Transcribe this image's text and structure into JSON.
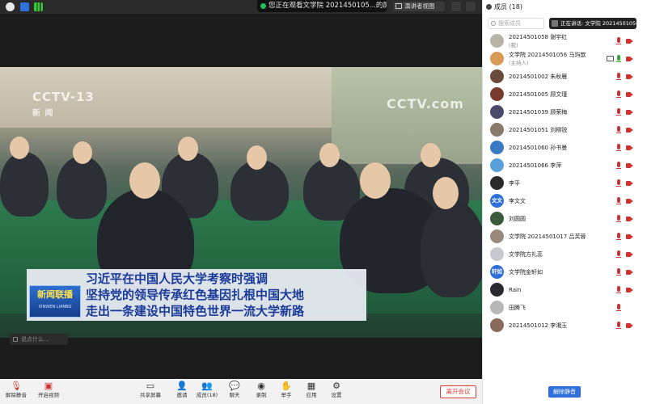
{
  "topbar": {
    "share_banner": "您正在观看文学院 20214501​05...的屏幕",
    "view_button": "演讲者视图"
  },
  "video": {
    "cctv_left": "CCTV-13",
    "cctv_left_sub": "新 闻",
    "cctv_right": "CCTV.com",
    "news_logo_cn": "新闻联播",
    "news_logo_py": "XINWEN LIANBO",
    "captions": [
      "习近平在中国人民大学考察时强调",
      "坚持党的领导传承红色基因扎根中国大地",
      "走出一条建设中国特色世界一流大学新路"
    ]
  },
  "chat_input": {
    "placeholder": "说点什么..."
  },
  "toolbar": {
    "items": [
      {
        "label": "解除静音",
        "icon": "mic-muted-icon"
      },
      {
        "label": "开启视频",
        "icon": "video-off-icon"
      },
      {
        "label": "共享屏幕",
        "icon": "share-screen-icon"
      },
      {
        "label": "邀请",
        "icon": "invite-icon"
      },
      {
        "label": "成员(18)",
        "icon": "members-icon"
      },
      {
        "label": "聊天",
        "icon": "chat-icon"
      },
      {
        "label": "录制",
        "icon": "record-icon"
      },
      {
        "label": "举手",
        "icon": "raise-hand-icon"
      },
      {
        "label": "应用",
        "icon": "apps-icon"
      },
      {
        "label": "设置",
        "icon": "settings-icon"
      }
    ],
    "leave_label": "离开会议"
  },
  "panel": {
    "title": "成员 (18)",
    "search_placeholder": "搜索成员",
    "speaking": "正在讲话: 文学院 20214501056...",
    "unmute_all": "解除静音",
    "members": [
      {
        "name": "20214501058 谢宇红",
        "sub": "(我)",
        "avatar_text": "",
        "avatar_color": "#b9b4a8",
        "mic": "muted",
        "cam": true,
        "screen": false
      },
      {
        "name": "文学院 20214501056 马玙歆",
        "sub": "(主持人)",
        "avatar_text": "",
        "avatar_color": "#d79b55",
        "mic": "on",
        "cam": true,
        "screen": true
      },
      {
        "name": "20214501002 朱秋雁",
        "sub": "",
        "avatar_text": "",
        "avatar_color": "#6a4a3a",
        "mic": "muted",
        "cam": true,
        "screen": false
      },
      {
        "name": "20214501005 顾文瑾",
        "sub": "",
        "avatar_text": "",
        "avatar_color": "#7a3b2e",
        "mic": "muted",
        "cam": true,
        "screen": false
      },
      {
        "name": "20214501039 顾荣梅",
        "sub": "",
        "avatar_text": "",
        "avatar_color": "#4a4a6a",
        "mic": "muted",
        "cam": true,
        "screen": false
      },
      {
        "name": "20214501051 刘柳锐",
        "sub": "",
        "avatar_text": "",
        "avatar_color": "#8a7a6a",
        "mic": "muted",
        "cam": true,
        "screen": false
      },
      {
        "name": "20214501060 孙书曼",
        "sub": "",
        "avatar_text": "",
        "avatar_color": "#3a7ac2",
        "mic": "muted",
        "cam": true,
        "screen": false
      },
      {
        "name": "20214501066 李萍",
        "sub": "",
        "avatar_text": "",
        "avatar_color": "#5aa0d8",
        "mic": "muted",
        "cam": true,
        "screen": false
      },
      {
        "name": "李平",
        "sub": "",
        "avatar_text": "",
        "avatar_color": "#2a2a2a",
        "mic": "muted",
        "cam": true,
        "screen": false
      },
      {
        "name": "李文文",
        "sub": "",
        "avatar_text": "文文",
        "avatar_color": "#2f6fd9",
        "mic": "muted",
        "cam": true,
        "screen": false
      },
      {
        "name": "刘圆圆",
        "sub": "",
        "avatar_text": "",
        "avatar_color": "#3a5a3a",
        "mic": "muted",
        "cam": true,
        "screen": false
      },
      {
        "name": "文学院 20214501017 吕芙蓉",
        "sub": "",
        "avatar_text": "",
        "avatar_color": "#9a8a7a",
        "mic": "muted",
        "cam": true,
        "screen": false
      },
      {
        "name": "文学院方礼蕊",
        "sub": "",
        "avatar_text": "",
        "avatar_color": "#c8c8d0",
        "mic": "muted",
        "cam": true,
        "screen": false
      },
      {
        "name": "文学院金轩如",
        "sub": "",
        "avatar_text": "轩如",
        "avatar_color": "#2f6fd9",
        "mic": "muted",
        "cam": true,
        "screen": false
      },
      {
        "name": "Rain",
        "sub": "",
        "avatar_text": "",
        "avatar_color": "#2a2a30",
        "mic": "muted",
        "cam": true,
        "screen": false
      },
      {
        "name": "田腾飞",
        "sub": "",
        "avatar_text": "",
        "avatar_color": "#b8b8b8",
        "mic": "muted",
        "cam": false,
        "screen": false
      },
      {
        "name": "20214501012 李湘玉",
        "sub": "",
        "avatar_text": "",
        "avatar_color": "#8a6a5a",
        "mic": "muted",
        "cam": true,
        "screen": false
      }
    ]
  }
}
